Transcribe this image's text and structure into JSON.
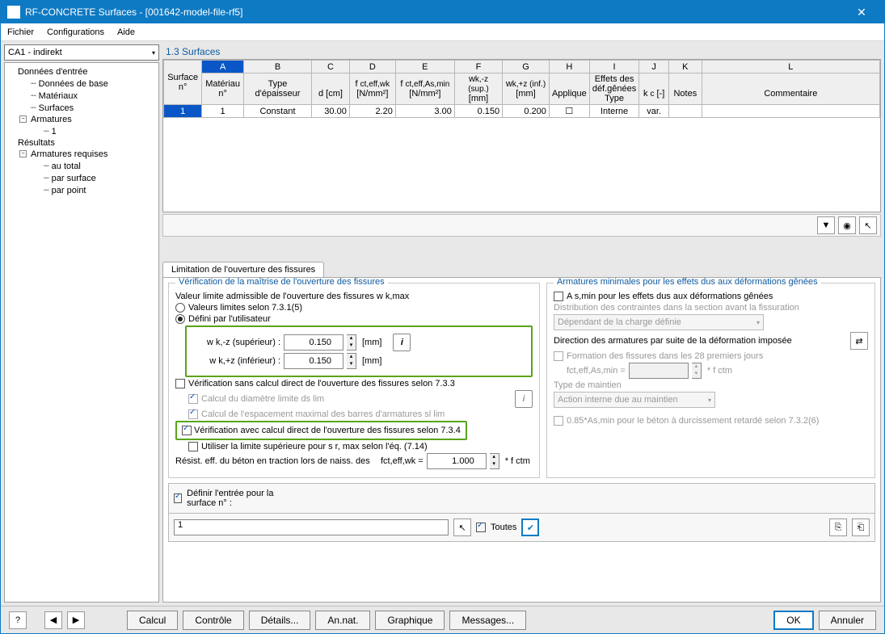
{
  "title": "RF-CONCRETE Surfaces - [001642-model-file-rf5]",
  "menus": [
    "Fichier",
    "Configurations",
    "Aide"
  ],
  "case_dropdown": "CA1 - indirekt",
  "tree": [
    {
      "label": "Données d'entrée",
      "level": 1
    },
    {
      "label": "Données de base",
      "level": 2,
      "dotted": true
    },
    {
      "label": "Matériaux",
      "level": 2,
      "dotted": true
    },
    {
      "label": "Surfaces",
      "level": 2,
      "dotted": true
    },
    {
      "label": "Armatures",
      "level": 2,
      "toggle": "-"
    },
    {
      "label": "1",
      "level": 3,
      "dotted": true
    },
    {
      "label": "Résultats",
      "level": 1
    },
    {
      "label": "Armatures requises",
      "level": 2,
      "toggle": "-"
    },
    {
      "label": "au total",
      "level": 3,
      "dotted": true
    },
    {
      "label": "par surface",
      "level": 3,
      "dotted": true
    },
    {
      "label": "par point",
      "level": 3,
      "dotted": true
    }
  ],
  "grid_title": "1.3 Surfaces",
  "grid_letters": [
    "A",
    "B",
    "C",
    "D",
    "E",
    "F",
    "G",
    "H",
    "I",
    "J",
    "K",
    "L"
  ],
  "grid_headers1": [
    "Surface",
    "Matériau",
    "Type",
    "",
    "f ct,eff,wk",
    "f ct,eff,As,min",
    "wk,-z (sup.)",
    "wk,+z (inf.)",
    "Effets des déf.gênées",
    "",
    "",
    "",
    ""
  ],
  "grid_headers2": [
    "n°",
    "n°",
    "d'épaisseur",
    "d [cm]",
    "[N/mm²]",
    "[N/mm²]",
    "[mm]",
    "[mm]",
    "Applique",
    "Type",
    "k c [-]",
    "Notes",
    "Commentaire"
  ],
  "grid_row": {
    "surf": "1",
    "mat": "1",
    "type": "Constant",
    "d": "30.00",
    "fct1": "2.20",
    "fct2": "3.00",
    "wk1": "0.150",
    "wk2": "0.200",
    "applique": "☐",
    "efftype": "Interne",
    "kc": "var.",
    "notes": "",
    "comment": ""
  },
  "tab_label": "Limitation de l'ouverture des fissures",
  "group1_legend": "Vérification de la maîtrise de l'ouverture des fissures",
  "g1_line1": "Valeur limite admissible de l'ouverture des fissures w k,max",
  "g1_radio1": "Valeurs limites selon 7.3.1(5)",
  "g1_radio2": "Défini par l'utilisateur",
  "g1_wk_sup_label": "w k,-z (supérieur) :",
  "g1_wk_sup_val": "0.150",
  "g1_wk_inf_label": "w k,+z (inférieur) :",
  "g1_wk_inf_val": "0.150",
  "g1_unit": "[mm]",
  "g1_check733": "Vérification sans calcul direct de l'ouverture des fissures selon 7.3.3",
  "g1_sub1": "Calcul du diamètre limite ds lim",
  "g1_sub2": "Calcul de l'espacement maximal des barres d'armatures sl lim",
  "g1_check734": "Vérification avec calcul direct de l'ouverture des fissures selon 7.3.4",
  "g1_sub734": "Utiliser la limite supérieure pour s r, max selon l'éq. (7.14)",
  "g1_resist": "Résist. eff. du béton en traction lors de naiss. des",
  "g1_fct_label": "fct,eff,wk =",
  "g1_fct_val": "1.000",
  "g1_fct_suffix": "* f ctm",
  "group2_legend": "Armatures minimales pour les effets dus aux déformations gênées",
  "g2_check_asmin": "A s,min pour les effets dus aux déformations gênées",
  "g2_distrib": "Distribution des contraintes dans la section avant la fissuration",
  "g2_distrib_val": "Dépendant de la charge définie",
  "g2_dir": "Direction des armatures par suite de la déformation imposée",
  "g2_form28": "Formation des fissures dans les 28 premiers jours",
  "g2_fct_label": "fct,eff,As,min =",
  "g2_fct_suffix": "* f ctm",
  "g2_type_maintien": "Type de maintien",
  "g2_type_maintien_val": "Action interne due au maintien",
  "g2_085": "0.85*As,min pour le béton à durcissement retardé selon 7.3.2(6)",
  "def_check": "Définir l'entrée pour la surface n° :",
  "def_value": "1",
  "def_toutes": "Toutes",
  "buttons": {
    "calcul": "Calcul",
    "controle": "Contrôle",
    "details": "Détails...",
    "annat": "An.nat.",
    "graphique": "Graphique",
    "messages": "Messages...",
    "ok": "OK",
    "annuler": "Annuler"
  }
}
